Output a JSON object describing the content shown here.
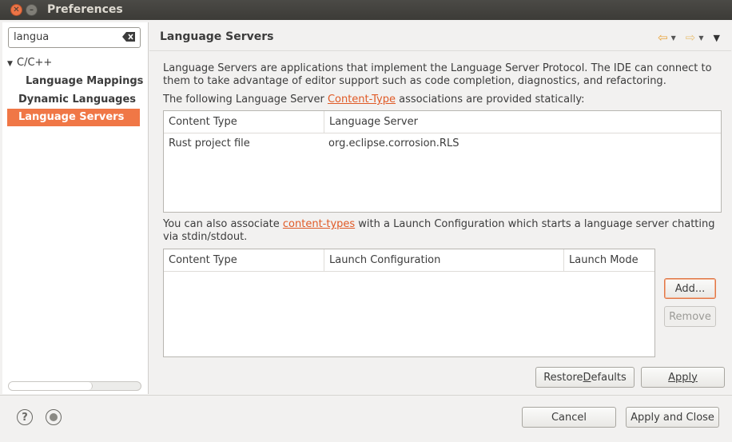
{
  "window": {
    "title": "Preferences"
  },
  "sidebar": {
    "filter_value": "langua",
    "tree": [
      {
        "label": "C/C++",
        "expanded": true
      },
      {
        "label": "Language Mappings"
      },
      {
        "label": "Dynamic Languages"
      },
      {
        "label": "Language Servers",
        "selected": true
      }
    ]
  },
  "page": {
    "title": "Language Servers",
    "intro_line1": "Language Servers are applications that implement the Language Server Protocol. The IDE can connect to",
    "intro_line2": "them to take advantage of editor support such as code completion, diagnostics, and refactoring.",
    "static_prefix": "The following Language Server ",
    "static_link": "Content-Type",
    "static_suffix": " associations are provided statically:",
    "static_table": {
      "columns": [
        "Content Type",
        "Language Server"
      ],
      "rows": [
        [
          "Rust project file",
          "org.eclipse.corrosion.RLS"
        ]
      ]
    },
    "launch_prefix": "You can also associate ",
    "launch_link": "content-types",
    "launch_suffix": " with a Launch Configuration which starts a language server chatting",
    "launch_line2": "via stdin/stdout.",
    "launch_table": {
      "columns": [
        "Content Type",
        "Launch Configuration",
        "Launch Mode"
      ],
      "rows": []
    },
    "add_label": "Add...",
    "remove_label": "Remove",
    "restore_label_pre": "Restore ",
    "restore_label_mnemonic": "D",
    "restore_label_post": "efaults",
    "apply_label": "Apply"
  },
  "footer": {
    "cancel_label": "Cancel",
    "apply_close_label": "Apply and Close"
  },
  "colors": {
    "accent": "#f07746",
    "link": "#e05a26",
    "titlebar": "#3c3b37"
  }
}
